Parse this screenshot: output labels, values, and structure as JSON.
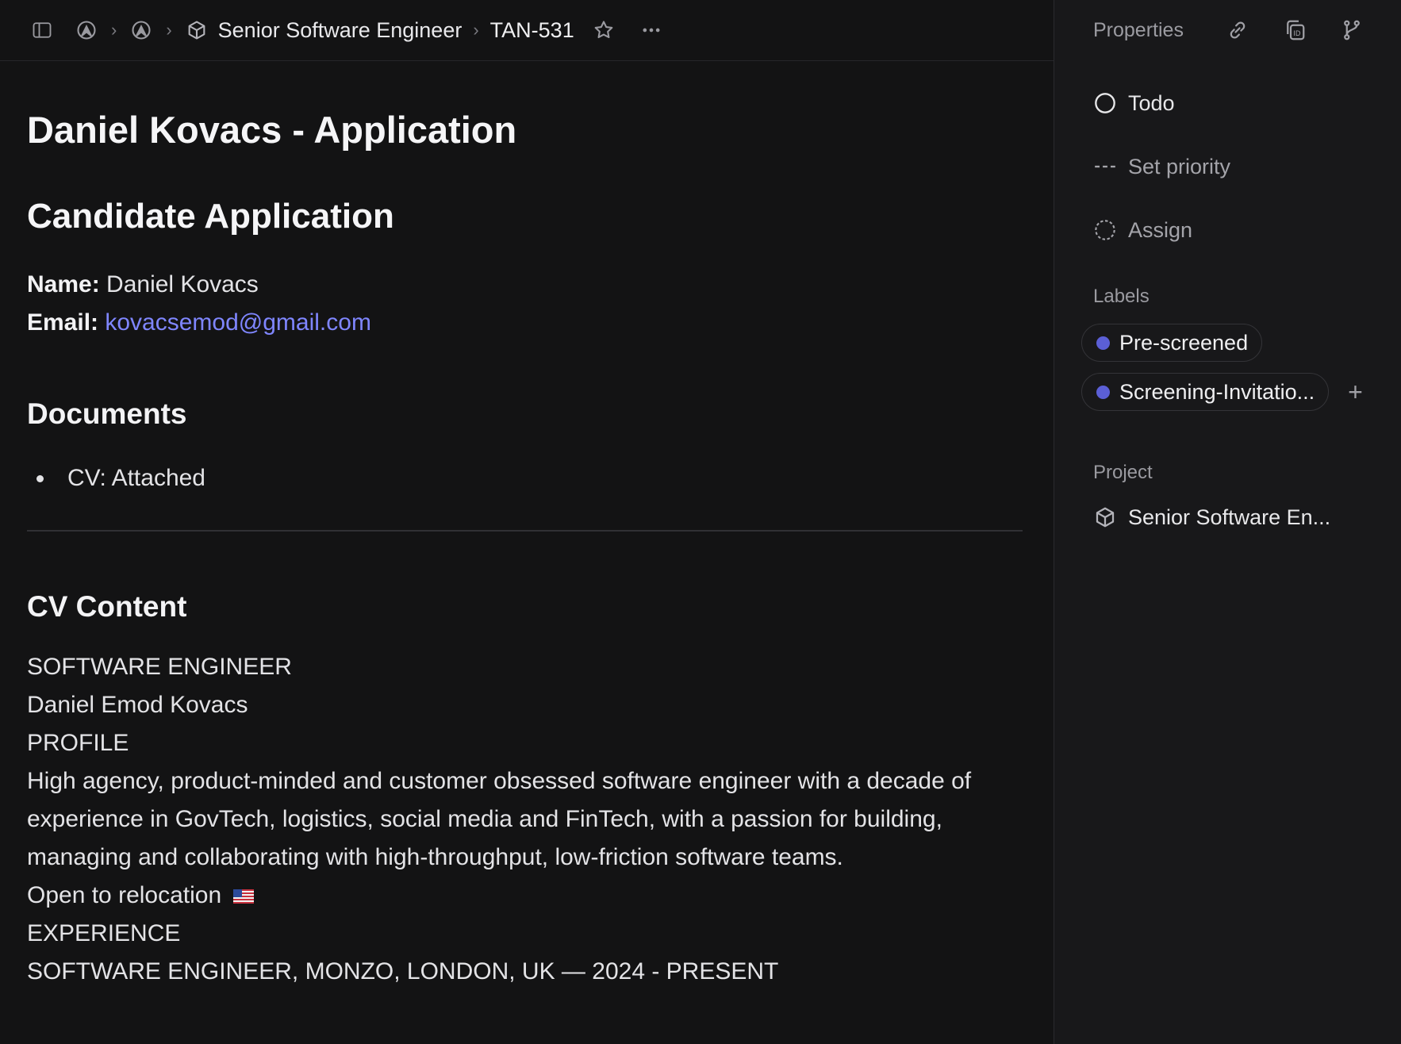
{
  "breadcrumb": {
    "project": "Senior Software Engineer",
    "issue_id": "TAN-531"
  },
  "doc": {
    "title": "Daniel Kovacs - Application",
    "heading": "Candidate Application",
    "name_label": "Name:",
    "name_value": "Daniel Kovacs",
    "email_label": "Email:",
    "email_value": "kovacsemod@gmail.com",
    "documents_heading": "Documents",
    "documents": [
      "CV: Attached"
    ],
    "cv_heading": "CV Content",
    "cv_lines": {
      "role": "SOFTWARE ENGINEER",
      "fullname": "Daniel Emod Kovacs",
      "profile_heading": "PROFILE",
      "profile_text": "High agency, product-minded and customer obsessed software engineer with a decade of experience in GovTech, logistics, social media and FinTech, with a passion for building, managing and collaborating with high-throughput, low-friction software teams.",
      "relocation": "Open to relocation",
      "experience_heading": "EXPERIENCE",
      "job1": "SOFTWARE ENGINEER, MONZO, LONDON, UK — 2024 - PRESENT"
    }
  },
  "sidebar": {
    "title": "Properties",
    "status": "Todo",
    "priority": "Set priority",
    "assign": "Assign",
    "labels_heading": "Labels",
    "labels": [
      "Pre-screened",
      "Screening-Invitatio..."
    ],
    "project_heading": "Project",
    "project": "Senior Software En...",
    "label_color": "#5b5fd6"
  },
  "colors": {
    "accent_link": "#7f86ff",
    "background": "#131314"
  }
}
